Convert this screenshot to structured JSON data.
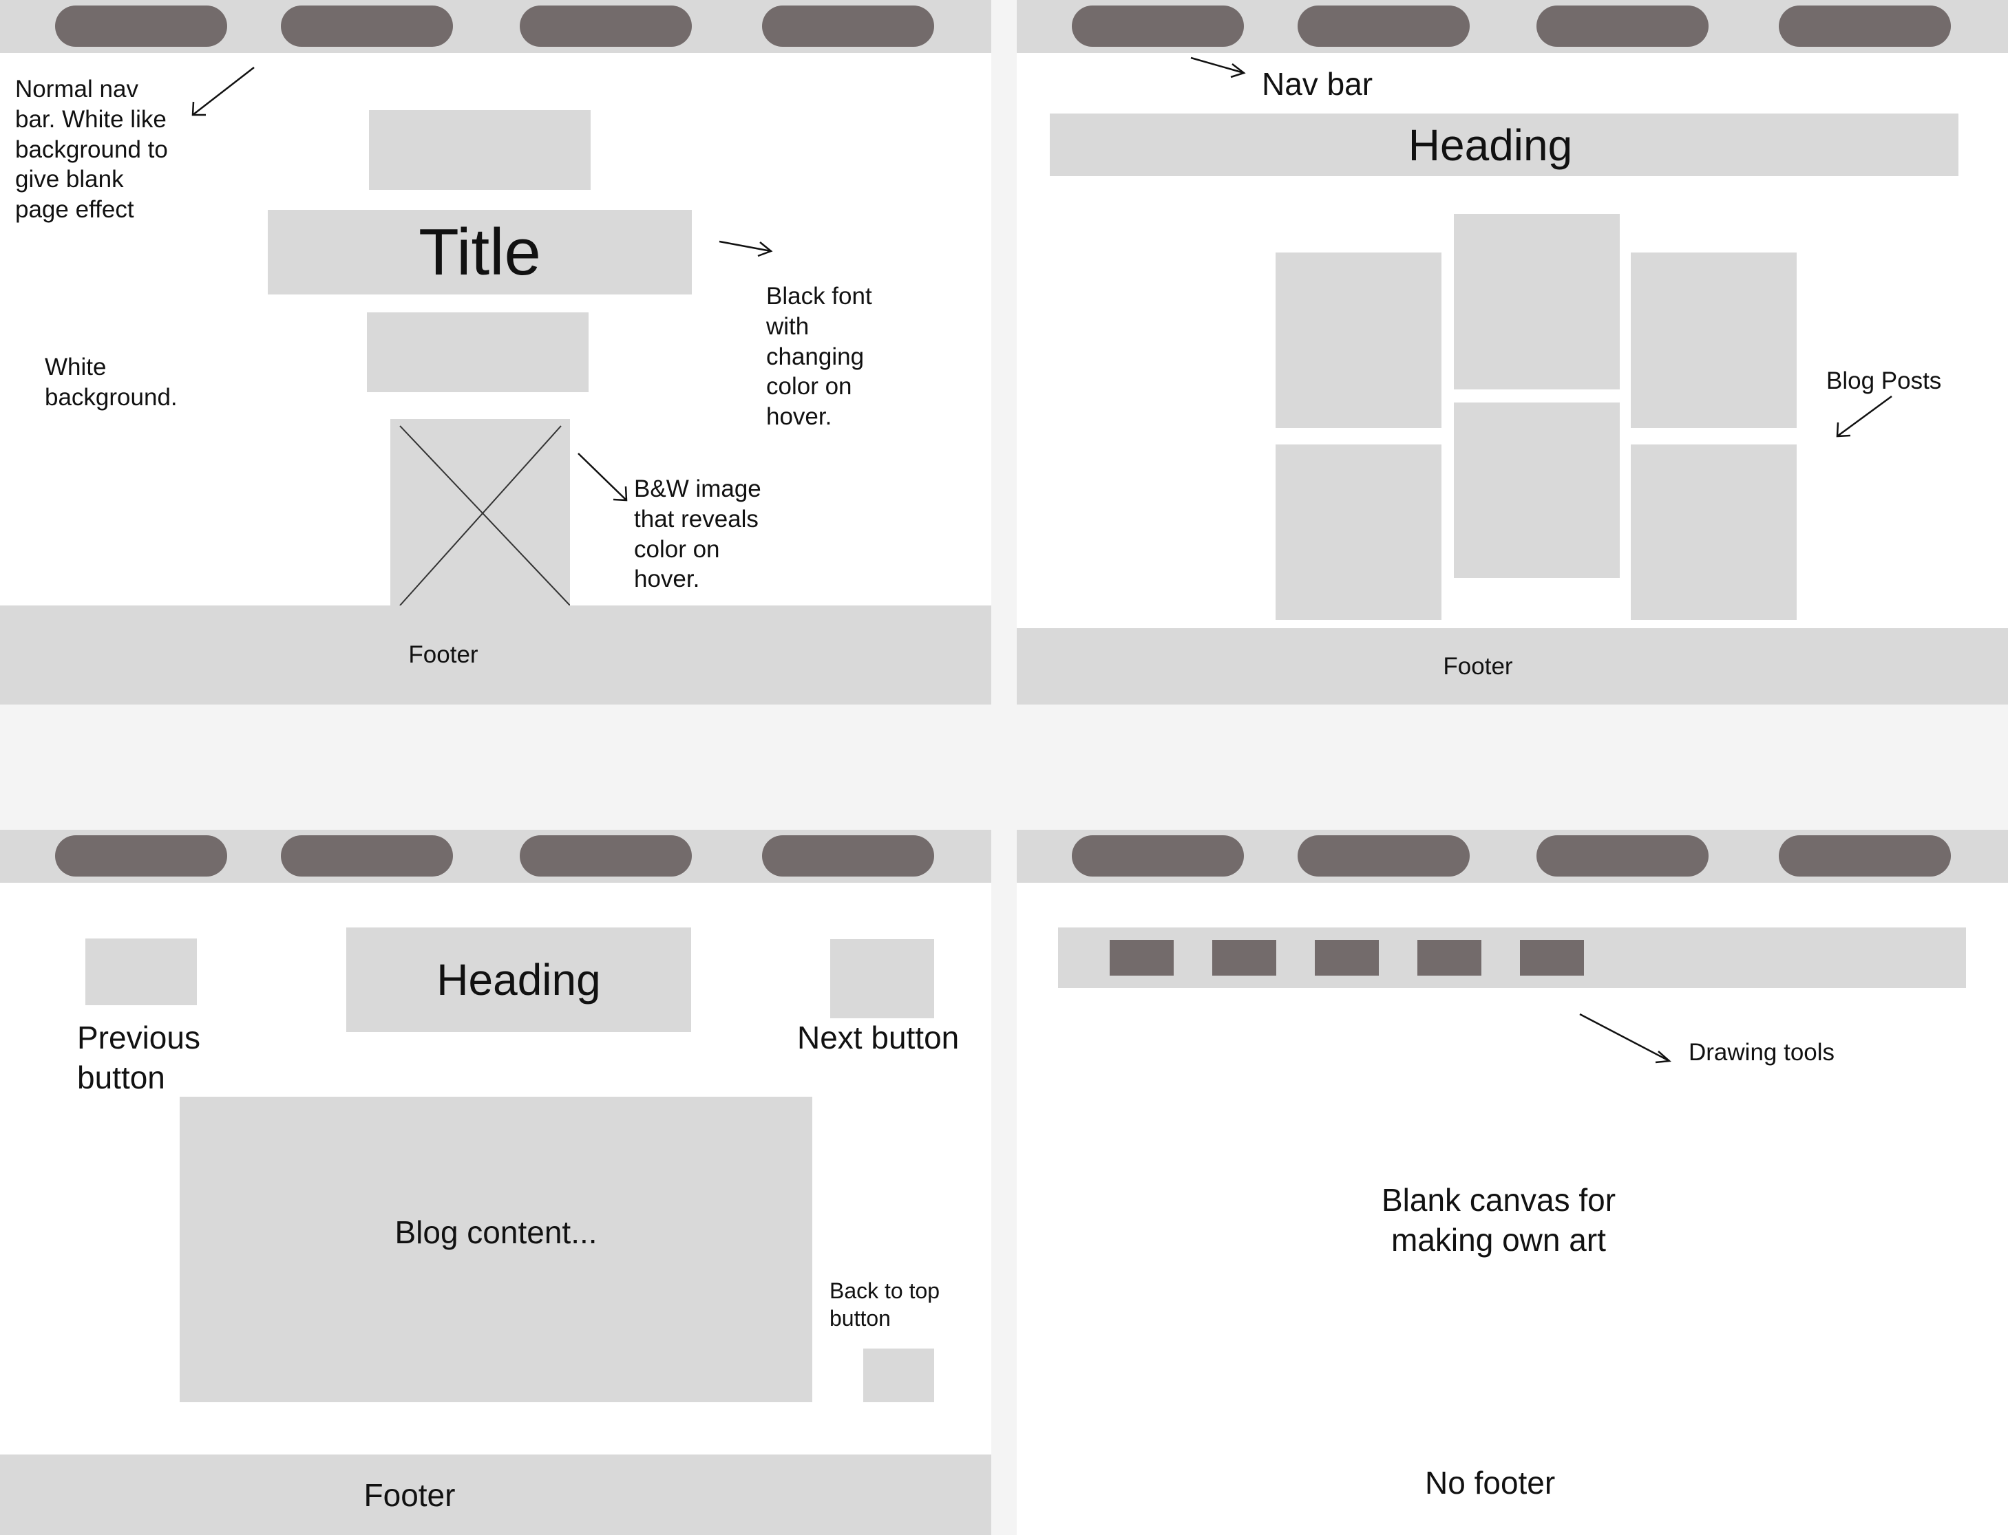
{
  "panel1": {
    "nav_note": "Normal nav\nbar. White like\nbackground to\ngive blank\npage effect",
    "bg_note": "White\nbackground.",
    "title": "Title",
    "font_note": "Black font\nwith\nchanging\ncolor on\nhover.",
    "image_note": "B&W image\nthat reveals\ncolor on\nhover.",
    "footer": "Footer"
  },
  "panel2": {
    "nav_note": "Nav bar",
    "heading": "Heading",
    "posts_note": "Blog Posts",
    "footer": "Footer"
  },
  "panel3": {
    "heading": "Heading",
    "previous_button": "Previous\nbutton",
    "next_button": "Next button",
    "content": "Blog content...",
    "back_to_top": "Back to top\nbutton",
    "footer": "Footer"
  },
  "panel4": {
    "tools_note": "Drawing tools",
    "canvas_note": "Blank canvas for\nmaking own art",
    "footer_note": "No footer"
  },
  "colors": {
    "placeholder": "#d9d9d9",
    "pill": "#736b6b",
    "page": "#ffffff",
    "gap": "#f4f4f4"
  }
}
